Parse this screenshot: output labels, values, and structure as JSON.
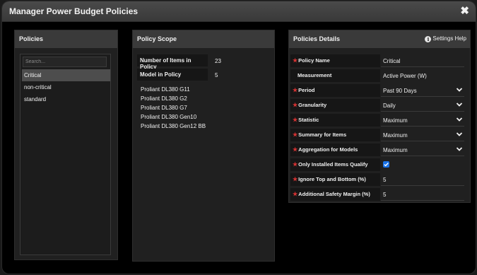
{
  "window": {
    "title": "Manager Power Budget Policies",
    "close_glyph": "✖"
  },
  "policies": {
    "header": "Policies",
    "search_placeholder": "Search...",
    "items": [
      {
        "label": "Critical",
        "selected": true
      },
      {
        "label": "non-critical",
        "selected": false
      },
      {
        "label": "standard",
        "selected": false
      }
    ]
  },
  "scope": {
    "header": "Policy Scope",
    "items_count_label": "Number of Items in Policy",
    "items_count": "23",
    "model_count_label": "Model in Policy",
    "model_count": "5",
    "models": [
      "Proliant DL380 G11",
      "Proliant DL380 G2",
      "Proliant DL380 G7",
      "Proliant DL380 Gen10",
      "Proliant DL380 Gen12 BB"
    ]
  },
  "details": {
    "header": "Policies Details",
    "help_label": "Settings Help",
    "help_icon": "info-icon",
    "accent_color": "#1a73e8",
    "required_color": "#d23232",
    "rows": [
      {
        "label": "Policy Name",
        "value": "Critical",
        "required": true,
        "type": "text"
      },
      {
        "label": "Measurement",
        "value": "Active Power (W)",
        "required": false,
        "type": "static"
      },
      {
        "label": "Period",
        "value": "Past 90 Days",
        "required": true,
        "type": "select"
      },
      {
        "label": "Granularity",
        "value": "Daily",
        "required": true,
        "type": "select"
      },
      {
        "label": "Statistic",
        "value": "Maximum",
        "required": true,
        "type": "select"
      },
      {
        "label": "Summary for Items",
        "value": "Maximum",
        "required": true,
        "type": "select"
      },
      {
        "label": "Aggregation for Models",
        "value": "Maximum",
        "required": true,
        "type": "select"
      },
      {
        "label": "Only Installed Items Qualify",
        "value": "",
        "required": true,
        "type": "checkbox",
        "checked": true
      },
      {
        "label": "Ignore Top and Bottom (%)",
        "value": "5",
        "required": true,
        "type": "text"
      },
      {
        "label": "Additional Safety Margin (%)",
        "value": "5",
        "required": true,
        "type": "text"
      }
    ]
  }
}
